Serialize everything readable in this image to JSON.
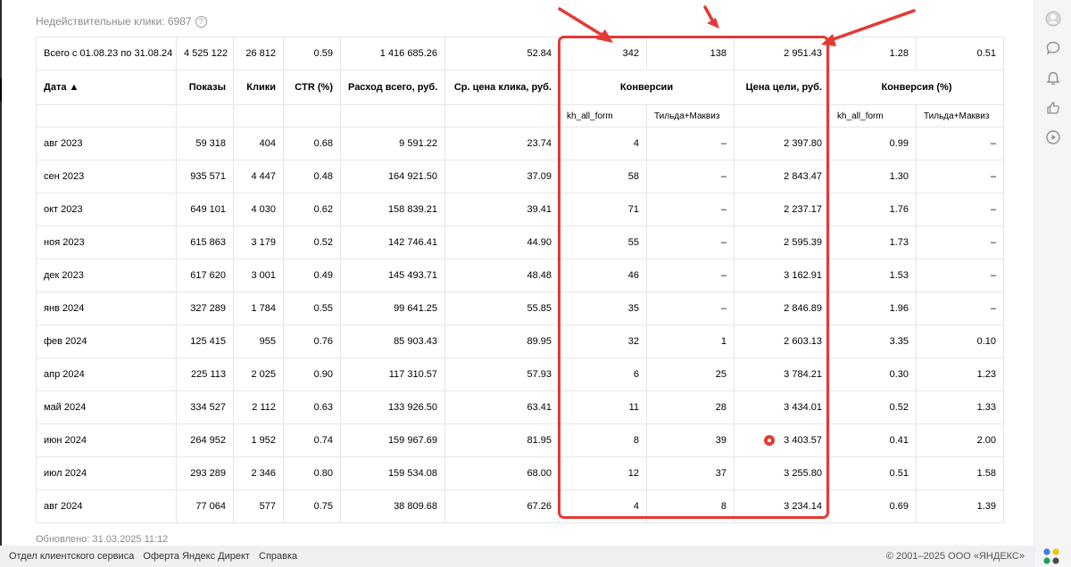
{
  "invalid_clicks": "Недействительные клики: 6987",
  "help_glyph": "?",
  "total_row": [
    "Всего с 01.08.23 по 31.08.24",
    "4 525 122",
    "26 812",
    "0.59",
    "1 416 685.26",
    "52.84",
    "342",
    "138",
    "2 951.43",
    "1.28",
    "0.51"
  ],
  "columns": {
    "date": "Дата ▲",
    "shows": "Показы",
    "clicks": "Клики",
    "ctr": "CTR (%)",
    "spend": "Расход всего, руб.",
    "cpc": "Ср. цена клика, руб.",
    "conversions": "Конверсии",
    "goal_price": "Цена цели, руб.",
    "conv_rate": "Конверсия (%)",
    "goal1": "kh_all_form",
    "goal2": "Тильда+Маквиз",
    "goal1_b": "kh_all_form",
    "goal2_b": "Тильда+Маквиз"
  },
  "rows": [
    [
      "авг 2023",
      "59 318",
      "404",
      "0.68",
      "9 591.22",
      "23.74",
      "4",
      "–",
      "2 397.80",
      "0.99",
      "–"
    ],
    [
      "сен 2023",
      "935 571",
      "4 447",
      "0.48",
      "164 921.50",
      "37.09",
      "58",
      "–",
      "2 843.47",
      "1.30",
      "–"
    ],
    [
      "окт 2023",
      "649 101",
      "4 030",
      "0.62",
      "158 839.21",
      "39.41",
      "71",
      "–",
      "2 237.17",
      "1.76",
      "–"
    ],
    [
      "ноя 2023",
      "615 863",
      "3 179",
      "0.52",
      "142 746.41",
      "44.90",
      "55",
      "–",
      "2 595.39",
      "1.73",
      "–"
    ],
    [
      "дек 2023",
      "617 620",
      "3 001",
      "0.49",
      "145 493.71",
      "48.48",
      "46",
      "–",
      "3 162.91",
      "1.53",
      "–"
    ],
    [
      "янв 2024",
      "327 289",
      "1 784",
      "0.55",
      "99 641.25",
      "55.85",
      "35",
      "–",
      "2 846.89",
      "1.96",
      "–"
    ],
    [
      "фев 2024",
      "125 415",
      "955",
      "0.76",
      "85 903.43",
      "89.95",
      "32",
      "1",
      "2 603.13",
      "3.35",
      "0.10"
    ],
    [
      "апр 2024",
      "225 113",
      "2 025",
      "0.90",
      "117 310.57",
      "57.93",
      "6",
      "25",
      "3 784.21",
      "0.30",
      "1.23"
    ],
    [
      "май 2024",
      "334 527",
      "2 112",
      "0.63",
      "133 926.50",
      "63.41",
      "11",
      "28",
      "3 434.01",
      "0.52",
      "1.33"
    ],
    [
      "июн 2024",
      "264 952",
      "1 952",
      "0.74",
      "159 967.69",
      "81.95",
      "8",
      "39",
      "3 403.57",
      "0.41",
      "2.00"
    ],
    [
      "июл 2024",
      "293 289",
      "2 346",
      "0.80",
      "159 534.08",
      "68.00",
      "12",
      "37",
      "3 255.80",
      "0.51",
      "1.58"
    ],
    [
      "авг 2024",
      "77 064",
      "577",
      "0.75",
      "38 809.68",
      "67.26",
      "4",
      "8",
      "3 234.14",
      "0.69",
      "1.39"
    ]
  ],
  "updated": "Обновлено: 31.03.2025 11:12",
  "footer": {
    "links": [
      "Отдел клиентского сервиса",
      "Оферта Яндекс Директ",
      "Справка"
    ],
    "copyright": "© 2001–2025 ООО «ЯНДЕКС»"
  },
  "sidebar_icons": [
    "avatar-icon",
    "chat-icon",
    "bell-icon",
    "thumbs-up-icon",
    "play-icon"
  ],
  "colors": {
    "highlight": "#e53935",
    "accent_red": "#e53935"
  }
}
